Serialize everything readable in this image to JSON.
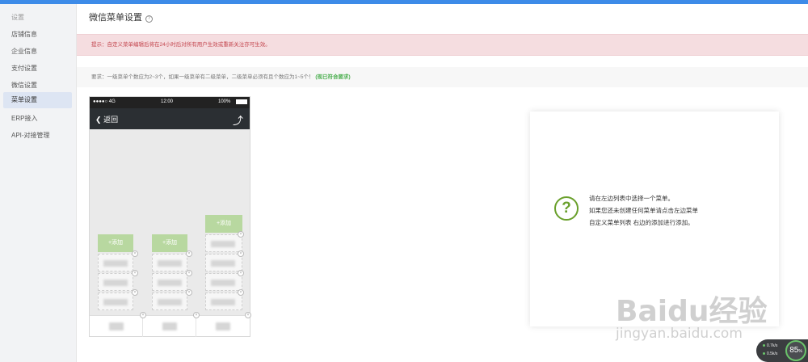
{
  "sidebar": {
    "items": [
      {
        "label": "设置"
      },
      {
        "label": "店铺信息"
      },
      {
        "label": "企业信息"
      },
      {
        "label": "支付设置"
      },
      {
        "label": "微信设置"
      },
      {
        "label": "菜单设置"
      },
      {
        "label": "ERP接入"
      },
      {
        "label": "API-对接管理"
      }
    ]
  },
  "page": {
    "title": "微信菜单设置",
    "help_glyph": "?"
  },
  "alert": {
    "text": "提示：自定义菜单编辑后将在24小时后对所有用户生效或重新关注亦可生效。"
  },
  "requirement": {
    "text": "要求：一级菜单个数应为2~3个，如果一级菜单有二级菜单，二级菜单必须有且个数应为1~5个！",
    "status": "(现已符合要求)"
  },
  "phone": {
    "signal": "●●●●○ 4G",
    "time": "12:00",
    "battery": "100%",
    "back_label": "返回",
    "add_label": "+添加",
    "remove_glyph": "×"
  },
  "hint": {
    "icon_glyph": "?",
    "line1": "请在左边列表中选择一个菜单。",
    "line2": "如果您还未创建任何菜单请点击左边菜单",
    "line3": "自定义菜单列表 右边的添加进行添加。"
  },
  "watermark": {
    "brand": "Bai",
    "brand_end": "du",
    "cn": "经验",
    "url": "jingyan.baidu.com"
  },
  "widget": {
    "up": "0.7k/s",
    "down": "0.5k/s",
    "percent": "85"
  },
  "colors": {
    "accent": "#3d8be8",
    "alert_text": "#c4474f",
    "ok": "#4caf50",
    "add_button": "#b8d8a0",
    "hint_icon": "#6aa02c"
  }
}
